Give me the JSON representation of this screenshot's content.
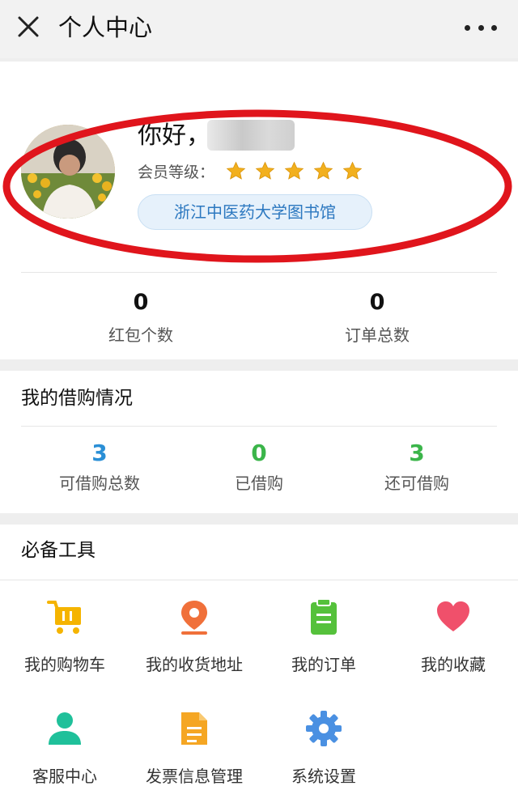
{
  "topbar": {
    "title": "个人中心"
  },
  "profile": {
    "greeting": "你好，",
    "level_label": "会员等级：",
    "level_stars": 5,
    "library": "浙江中医药大学图书馆",
    "stats": [
      {
        "value": "0",
        "label": "红包个数"
      },
      {
        "value": "0",
        "label": "订单总数"
      }
    ]
  },
  "borrow": {
    "title": "我的借购情况",
    "stats": [
      {
        "value": "3",
        "label": "可借购总数",
        "color": "#2a8fd6"
      },
      {
        "value": "0",
        "label": "已借购",
        "color": "#3bb54a"
      },
      {
        "value": "3",
        "label": "还可借购",
        "color": "#3bb54a"
      }
    ]
  },
  "tools": {
    "title": "必备工具",
    "items": [
      {
        "label": "我的购物车",
        "icon": "shopping-cart-icon",
        "color": "#f5b400"
      },
      {
        "label": "我的收货地址",
        "icon": "location-pin-icon",
        "color": "#f0703a"
      },
      {
        "label": "我的订单",
        "icon": "clipboard-icon",
        "color": "#55c13b"
      },
      {
        "label": "我的收藏",
        "icon": "heart-icon",
        "color": "#f0506b"
      },
      {
        "label": "客服中心",
        "icon": "user-icon",
        "color": "#1fc09a"
      },
      {
        "label": "发票信息管理",
        "icon": "document-icon",
        "color": "#f5a623"
      },
      {
        "label": "系统设置",
        "icon": "gear-icon",
        "color": "#4a90e2"
      }
    ]
  },
  "colors": {
    "annotation_ellipse": "#e0151c",
    "star": "#f2b01e"
  }
}
